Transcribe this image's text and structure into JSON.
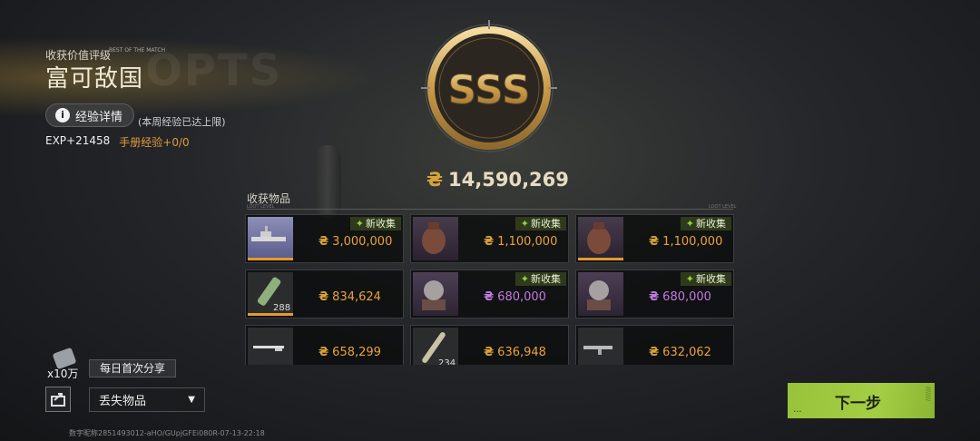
{
  "rating": {
    "label": "收获价值评级",
    "mini_note": "BEST OF THE MATCH",
    "title": "富可敌国",
    "grade": "SSS"
  },
  "exp": {
    "details_button": "经验详情",
    "limit_note": "(本周经验已达上限)",
    "exp_gain": "EXP+21458",
    "manual_exp": "手册经验+0/0"
  },
  "total_value": "14,590,269",
  "loot_section": {
    "title": "收获物品",
    "new_tag": "新收集",
    "items": [
      {
        "name": "warship",
        "price": "3,000,000",
        "is_new": true,
        "qty": "",
        "price_color": "orange"
      },
      {
        "name": "vase",
        "price": "1,100,000",
        "is_new": true,
        "qty": "",
        "price_color": "orange"
      },
      {
        "name": "vase",
        "price": "1,100,000",
        "is_new": true,
        "qty": "",
        "price_color": "orange"
      },
      {
        "name": "ammo",
        "price": "834,624",
        "is_new": false,
        "qty": "288",
        "price_color": "orange"
      },
      {
        "name": "lion-statue",
        "price": "680,000",
        "is_new": true,
        "qty": "",
        "price_color": "purple"
      },
      {
        "name": "lion-statue",
        "price": "680,000",
        "is_new": true,
        "qty": "",
        "price_color": "purple"
      },
      {
        "name": "rifle",
        "price": "658,299",
        "is_new": false,
        "qty": "",
        "price_color": "orange"
      },
      {
        "name": "bullet",
        "price": "636,948",
        "is_new": false,
        "qty": "234",
        "price_color": "orange"
      },
      {
        "name": "assault-rifle",
        "price": "632,062",
        "is_new": false,
        "qty": "",
        "price_color": "orange"
      }
    ]
  },
  "share": {
    "bonus_qty": "x10万",
    "badge": "每日首次分享"
  },
  "dropdown": {
    "selected": "丢失物品"
  },
  "footer_id": "数字昵称2851493012-aHO/GUpjGFEi080R-07-13-22:18",
  "next_button": "下一步",
  "colors": {
    "accent_gold": "#d8a23a",
    "price_orange": "#eaa23c",
    "price_purple": "#c27ae0",
    "next_green": "#a4cf44"
  }
}
